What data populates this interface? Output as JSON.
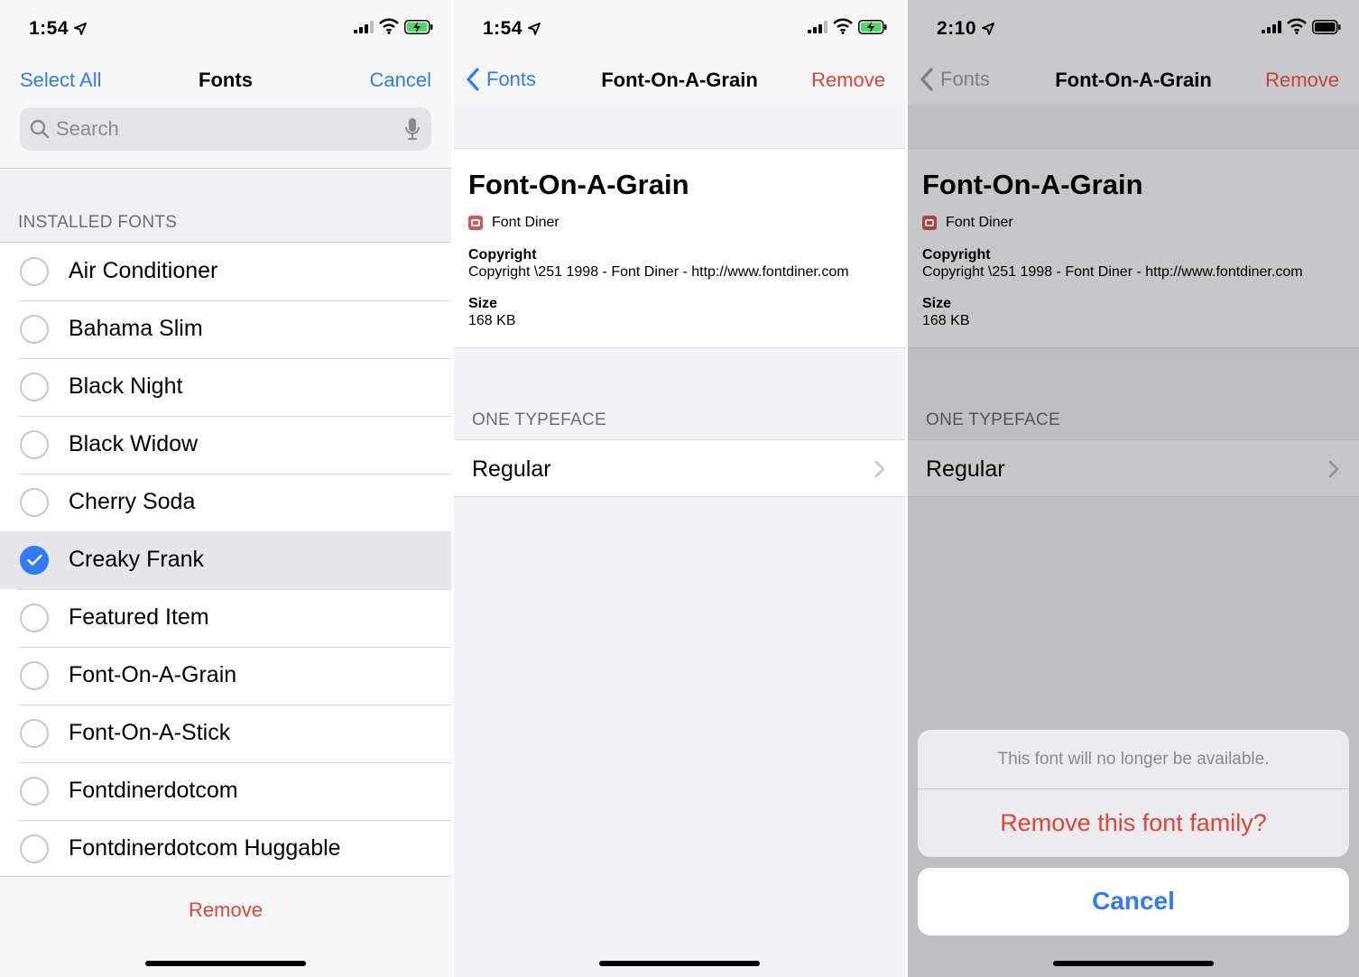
{
  "screen1": {
    "status": {
      "time": "1:54"
    },
    "nav": {
      "left": "Select All",
      "title": "Fonts",
      "right": "Cancel"
    },
    "search": {
      "placeholder": "Search"
    },
    "section_header": "INSTALLED FONTS",
    "fonts": [
      {
        "name": "Air Conditioner",
        "checked": false
      },
      {
        "name": "Bahama Slim",
        "checked": false
      },
      {
        "name": "Black Night",
        "checked": false
      },
      {
        "name": "Black Widow",
        "checked": false
      },
      {
        "name": "Cherry Soda",
        "checked": false
      },
      {
        "name": "Creaky Frank",
        "checked": true
      },
      {
        "name": "Featured Item",
        "checked": false
      },
      {
        "name": "Font-On-A-Grain",
        "checked": false
      },
      {
        "name": "Font-On-A-Stick",
        "checked": false
      },
      {
        "name": "Fontdinerdotcom",
        "checked": false
      },
      {
        "name": "Fontdinerdotcom Huggable",
        "checked": false
      }
    ],
    "bottom_action": "Remove"
  },
  "screen2": {
    "status": {
      "time": "1:54"
    },
    "nav": {
      "back": "Fonts",
      "title": "Font-On-A-Grain",
      "right": "Remove"
    },
    "info": {
      "title": "Font-On-A-Grain",
      "maker": "Font Diner",
      "copyright_label": "Copyright",
      "copyright_value": "Copyright \\251 1998 - Font Diner - http://www.fontdiner.com",
      "size_label": "Size",
      "size_value": "168 KB"
    },
    "section_header": "ONE TYPEFACE",
    "typeface": "Regular"
  },
  "screen3": {
    "status": {
      "time": "2:10"
    },
    "nav": {
      "back": "Fonts",
      "title": "Font-On-A-Grain",
      "right": "Remove"
    },
    "info": {
      "title": "Font-On-A-Grain",
      "maker": "Font Diner",
      "copyright_label": "Copyright",
      "copyright_value": "Copyright \\251 1998 - Font Diner - http://www.fontdiner.com",
      "size_label": "Size",
      "size_value": "168 KB"
    },
    "section_header": "ONE TYPEFACE",
    "typeface": "Regular",
    "action_sheet": {
      "message": "This font will no longer be available.",
      "destructive": "Remove this font family?",
      "cancel": "Cancel"
    }
  },
  "colors": {
    "accent": "#2f7cf6",
    "destructive": "#e0443a",
    "dim_overlay": "#c7c7c9"
  }
}
